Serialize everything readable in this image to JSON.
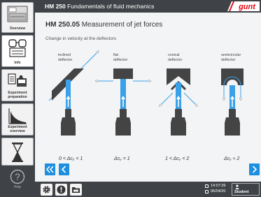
{
  "header": {
    "product_code": "HM 250",
    "product_name": "Fundamentals of fluid mechanics",
    "logo_text": "gunt"
  },
  "sidebar": {
    "items": [
      {
        "label": "Overview",
        "icon": "device-icon"
      },
      {
        "label": "Info",
        "icon": "glasses-icon"
      },
      {
        "label": "Experiment preparation",
        "icon": "experiment-setup-icon"
      },
      {
        "label": "Experiment overview",
        "icon": "curve-chart-icon"
      },
      {
        "label": "",
        "icon": "hourglass-icon"
      }
    ],
    "help_label": "Help"
  },
  "page": {
    "code": "HM 250.05",
    "title": "Measurement of jet forces",
    "subtitle": "Change in velocity at the deflectors"
  },
  "deflectors": [
    {
      "name": "inclined deflector",
      "condition": "0 < Δcᵧ < 1"
    },
    {
      "name": "flat deflector",
      "condition": "Δcᵧ = 1"
    },
    {
      "name": "conical deflector",
      "condition": "1 < Δcᵧ < 2"
    },
    {
      "name": "semicircular deflector",
      "condition": "Δcᵧ ≈ 2"
    }
  ],
  "toolbar": {
    "icons": [
      "gear-icon",
      "warning-icon",
      "folder-icon"
    ]
  },
  "status": {
    "time": "14:07:39",
    "date": "06/04/20",
    "user": "Student"
  },
  "colors": {
    "accent": "#1e8fe0",
    "chrome": "#3f4246",
    "content_bg": "#f3f4f5",
    "logo_red": "#e30613",
    "jet": "#3aa0e8"
  }
}
